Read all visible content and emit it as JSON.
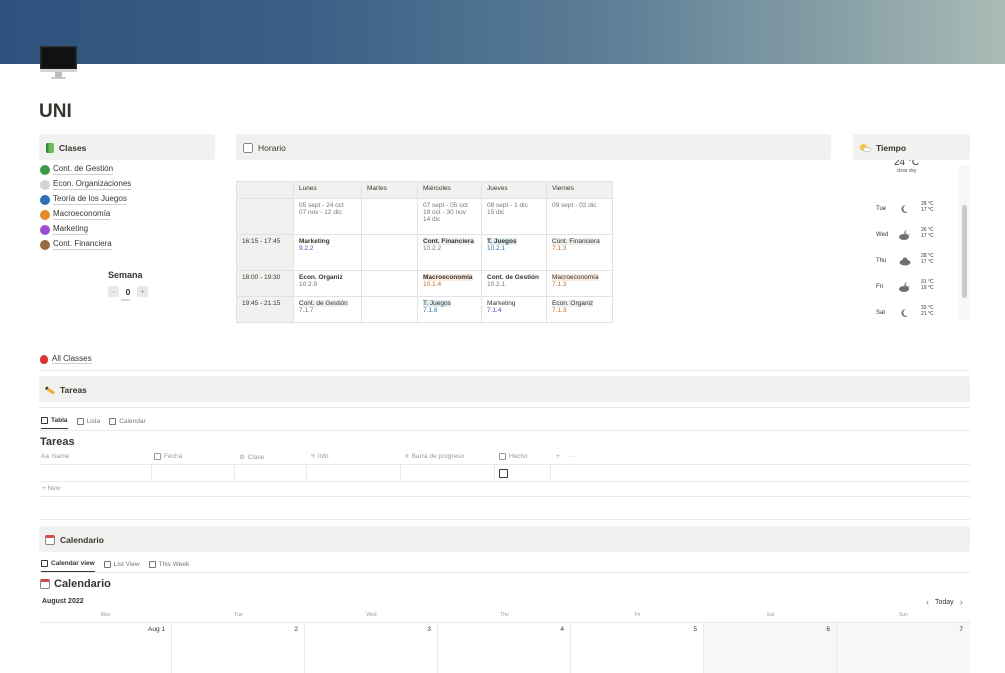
{
  "cover": {
    "color_start": "#2d527e",
    "color_end": "#a9bbb5"
  },
  "page": {
    "icon": "computer-icon",
    "title": "UNI"
  },
  "clases": {
    "title": "Clases",
    "icon": "book-icon",
    "items": [
      {
        "label": "Cont. de Gestión",
        "color": "#3f9a47"
      },
      {
        "label": "Econ. Organizaciones",
        "color": "#cfd4d8"
      },
      {
        "label": "Teoría de los Juegos",
        "color": "#2e6fb5"
      },
      {
        "label": "Macroeconomía",
        "color": "#e58b2c"
      },
      {
        "label": "Marketing",
        "color": "#9b4fd0"
      },
      {
        "label": "Cont. Financiera",
        "color": "#9a6a43"
      }
    ],
    "counter": {
      "title": "Semana",
      "value": "0",
      "minus": "-",
      "plus": "+",
      "note": "reset"
    }
  },
  "horario": {
    "title": "Horario",
    "icon": "calendar-tear-icon",
    "headers": [
      "",
      "Lunes",
      "Martes",
      "Miércoles",
      "Jueves",
      "Viernes"
    ],
    "dates": [
      "",
      "05 sept - 24 oct\n07 nov - 12 dic",
      "",
      "07 sept - 05 oct\n19 oct - 30 nov\n14 dic",
      "08 sept - 1 dic\n15 dic",
      "09 sept - 02 dic"
    ],
    "rows": [
      {
        "time": "16:15 - 17:45",
        "cells": [
          {
            "name": "Marketing",
            "room": "9.2.2",
            "style": "p",
            "bold": true
          },
          {
            "name": "",
            "room": ""
          },
          {
            "name": "Cont. Financiera",
            "room": "10.2.2",
            "style": "g",
            "bold": true,
            "hl": "g"
          },
          {
            "name": "T. Juegos",
            "room": "10.2.1",
            "style": "b",
            "bold": true,
            "hl": "b"
          },
          {
            "name": "Cont. Financiera",
            "room": "7.1.3",
            "style": "o",
            "hl": "g"
          }
        ]
      },
      {
        "time": "18:00 - 19:30",
        "cells": [
          {
            "name": "Econ. Organiz",
            "room": "10.2.9",
            "style": "g",
            "bold": true
          },
          {
            "name": "",
            "room": ""
          },
          {
            "name": "Macroeconomía",
            "room": "10.1.4",
            "style": "o",
            "bold": true,
            "hl": "o"
          },
          {
            "name": "Cont. de Gestión",
            "room": "10.2.1",
            "style": "g",
            "bold": true
          },
          {
            "name": "Macroeconomía",
            "room": "7.1.3",
            "style": "o",
            "hl": "o"
          }
        ]
      },
      {
        "time": "19:45 - 21:15",
        "cells": [
          {
            "name": "Cont. de Gestión",
            "room": "7.1.7",
            "style": "g",
            "hl": "g"
          },
          {
            "name": "",
            "room": ""
          },
          {
            "name": "T. Juegos",
            "room": "7.1.8",
            "style": "b",
            "hl": "b"
          },
          {
            "name": "Marketing",
            "room": "7.1.4",
            "style": "p"
          },
          {
            "name": "Econ. Organiz",
            "room": "7.1.3",
            "style": "o",
            "hl": "g"
          }
        ]
      }
    ]
  },
  "tiempo": {
    "title": "Tiempo",
    "icon": "sun-cloud-icon",
    "current": {
      "temp": "24 °C",
      "desc": "clear sky"
    },
    "days": [
      {
        "day": "Tue",
        "hi": "28 °C",
        "lo": "17 °C",
        "icon": "moon-icon"
      },
      {
        "day": "Wed",
        "hi": "26 °C",
        "lo": "17 °C",
        "icon": "cloud-moon-icon"
      },
      {
        "day": "Thu",
        "hi": "28 °C",
        "lo": "17 °C",
        "icon": "cloud-icon"
      },
      {
        "day": "Fri",
        "hi": "31 °C",
        "lo": "19 °C",
        "icon": "cloud-moon-icon"
      },
      {
        "day": "Sat",
        "hi": "33 °C",
        "lo": "21 °C",
        "icon": "moon-icon"
      }
    ]
  },
  "all_classes": {
    "label": "All Classes",
    "icon": "apple-icon"
  },
  "tareas": {
    "callout_title": "Tareas",
    "icon": "pencil-icon",
    "views": [
      "Tabla",
      "Lista",
      "Calendar"
    ],
    "title": "Tareas",
    "columns": [
      "Name",
      "Fecha",
      "Clase",
      "Info",
      "Barra de progreso",
      "Hecho"
    ],
    "add_column": "+",
    "more": "···",
    "new_label": "+ New"
  },
  "calendario": {
    "callout_title": "Calendario",
    "icon": "calendar-icon",
    "views": [
      "Calendar view",
      "List View",
      "This Week"
    ],
    "title": "Calendario",
    "month": "August 2022",
    "today": "Today",
    "prev": "‹",
    "next": "›",
    "weekdays": [
      "Mon",
      "Tue",
      "Wed",
      "Thu",
      "Fri",
      "Sat",
      "Sun"
    ],
    "days": [
      "Aug 1",
      "2",
      "3",
      "4",
      "5",
      "6",
      "7"
    ]
  }
}
